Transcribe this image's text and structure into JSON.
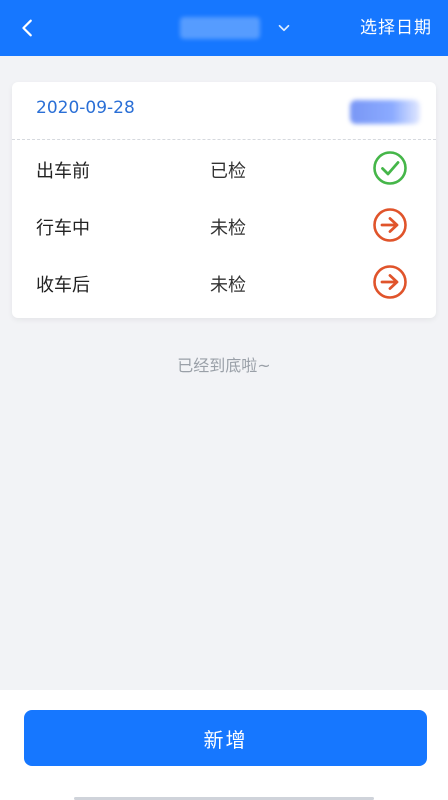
{
  "header": {
    "select_date_label": "选择日期",
    "accent_color": "#1677ff"
  },
  "card": {
    "date": "2020-09-28",
    "rows": [
      {
        "label": "出车前",
        "status": "已检",
        "icon": "check-circle-icon",
        "icon_color": "#45b649"
      },
      {
        "label": "行车中",
        "status": "未检",
        "icon": "arrow-right-circle-icon",
        "icon_color": "#e0542b"
      },
      {
        "label": "收车后",
        "status": "未检",
        "icon": "arrow-right-circle-icon",
        "icon_color": "#e0542b"
      }
    ]
  },
  "footer_note": "已经到底啦~",
  "bottom": {
    "add_label": "新增"
  }
}
